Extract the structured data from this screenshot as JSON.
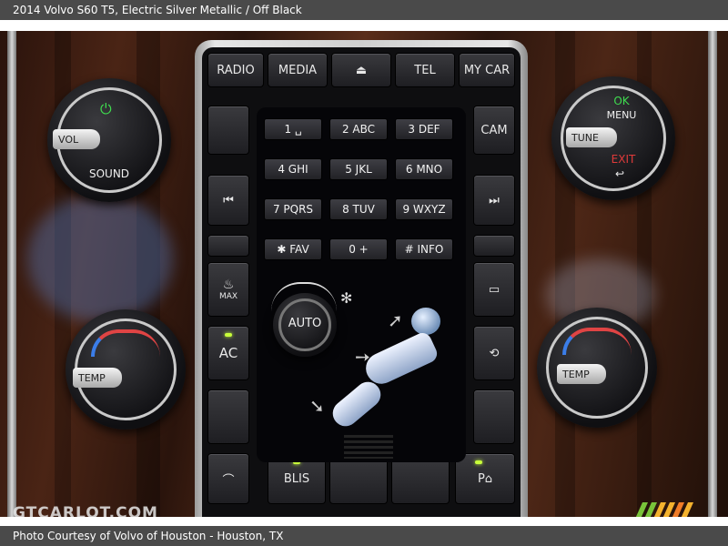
{
  "header": {
    "caption": "2014 Volvo S60 T5,   Electric Silver Metallic / Off Black"
  },
  "footer": {
    "credit": "Photo Courtesy of Volvo of Houston - Houston, TX"
  },
  "watermark": "GTCARLOT.COM",
  "console": {
    "top_buttons": [
      "RADIO",
      "MEDIA",
      "⏏",
      "TEL",
      "MY CAR"
    ],
    "cam": "CAM",
    "prev": "⏮",
    "next": "⏭",
    "keys": [
      [
        "1  ␣",
        "2  ABC",
        "3  DEF"
      ],
      [
        "4  GHI",
        "5  JKL",
        "6  MNO"
      ],
      [
        "7  PQRS",
        "8  TUV",
        "9  WXYZ"
      ],
      [
        "✱  FAV",
        "0   +",
        "#  INFO"
      ]
    ],
    "max_label": "MAX",
    "ac_label": "AC",
    "auto_label": "AUTO",
    "blis_label": "BLIS",
    "left_top_knob": {
      "label": "VOL",
      "sub": "SOUND"
    },
    "right_top_knob": {
      "ok": "OK",
      "menu": "MENU",
      "tune": "TUNE",
      "exit": "EXIT"
    },
    "left_temp_knob": "TEMP",
    "right_temp_knob": "TEMP"
  },
  "colors": {
    "ok_green": "#3fdc4f",
    "exit_red": "#e03a3a",
    "led": "#c8ff3a",
    "temp_blue": "#3b7de8",
    "temp_red": "#e04444"
  }
}
